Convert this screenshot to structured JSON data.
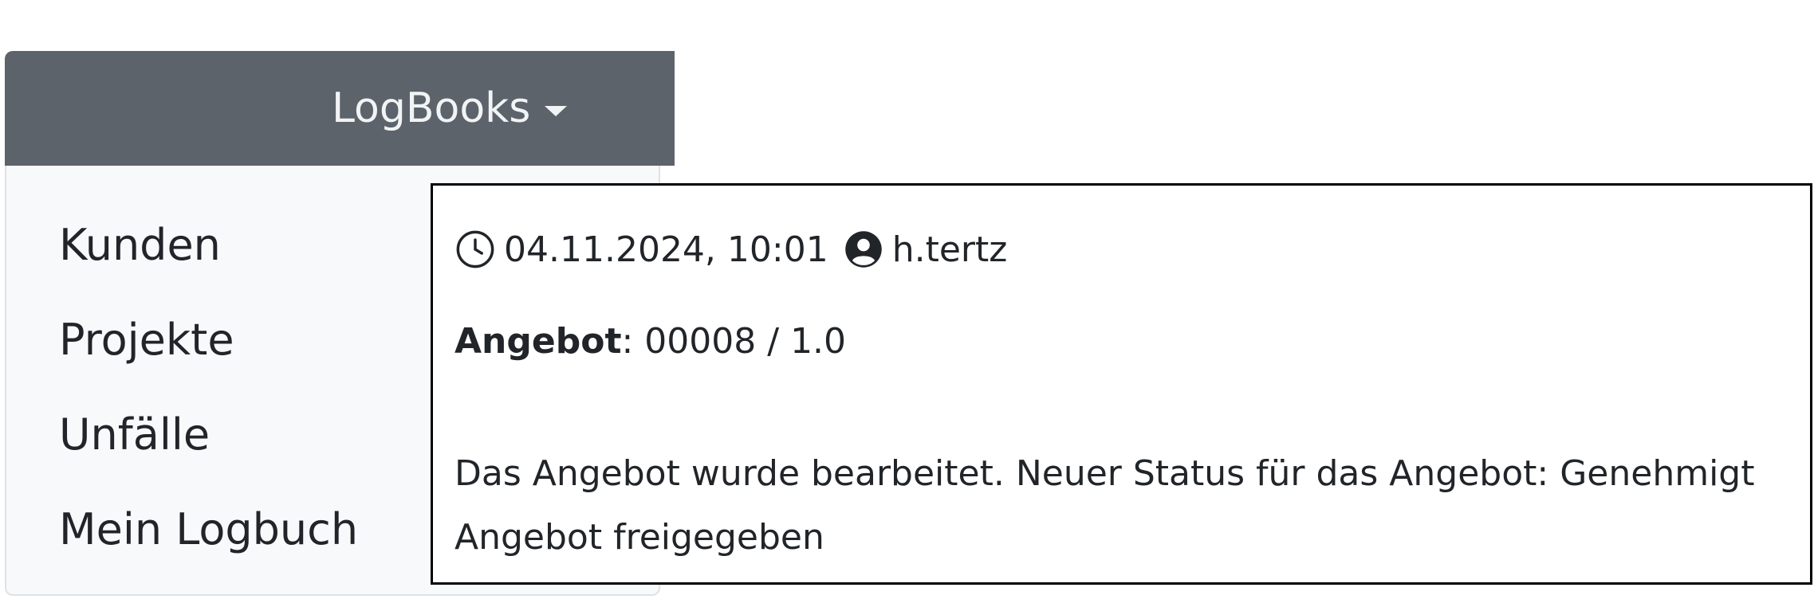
{
  "navbar": {
    "toggle_label": "LogBooks"
  },
  "dropdown": {
    "items": [
      {
        "label": "Kunden"
      },
      {
        "label": "Projekte"
      },
      {
        "label": "Unfälle"
      },
      {
        "label": "Mein Logbuch"
      }
    ]
  },
  "tooltip": {
    "timestamp": "04.11.2024, 10:01",
    "user": "h.tertz",
    "offer_label": "Angebot",
    "offer_value": ": 00008 / 1.0",
    "message_line1": "Das Angebot wurde bearbeitet. Neuer Status für das Angebot: Genehmigt",
    "message_line2": "Angebot freigegeben"
  },
  "icons": {
    "clock": "clock-icon",
    "user": "person-circle-icon"
  },
  "colors": {
    "navbar_background": "#5c636a",
    "navbar_text": "#f2f3f5",
    "menu_background": "#f8f9fa",
    "text": "#212529",
    "tooltip_border": "#000000"
  }
}
